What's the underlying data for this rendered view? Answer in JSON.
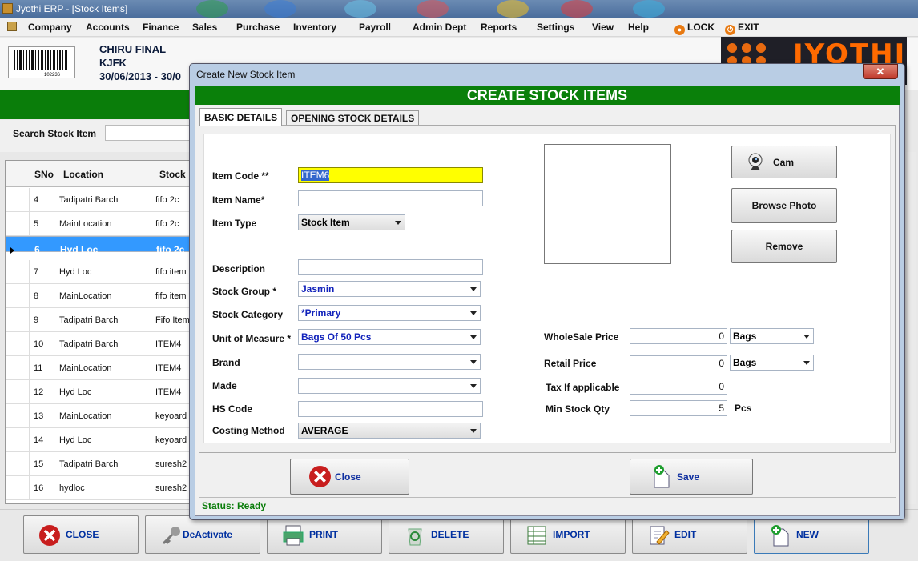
{
  "window": {
    "title": "Jyothi ERP - [Stock Items]"
  },
  "menu": [
    "Company",
    "Accounts",
    "Finance",
    "Sales",
    "Purchase",
    "Inventory",
    "Payroll",
    "Admin Dept",
    "Reports",
    "Settings",
    "View",
    "Help"
  ],
  "lock_label": "LOCK",
  "exit_label": "EXIT",
  "company": {
    "name": "CHIRU FINAL",
    "code": "KJFK",
    "period": "30/06/2013 - 30/0"
  },
  "barcode_text": "102236",
  "brand_logo": "JYOTHI",
  "search": {
    "label": "Search Stock Item",
    "value": ""
  },
  "grid": {
    "columns": [
      "SNo",
      "Location",
      "Stock"
    ],
    "rows": [
      {
        "sno": "4",
        "location": "Tadipatri Barch",
        "stock": "fifo 2c"
      },
      {
        "sno": "5",
        "location": "MainLocation",
        "stock": "fifo 2c"
      },
      {
        "sno": "6",
        "location": "Hyd Loc",
        "stock": "fifo 2c"
      },
      {
        "sno": "7",
        "location": "Hyd Loc",
        "stock": "fifo item"
      },
      {
        "sno": "8",
        "location": "MainLocation",
        "stock": "fifo item"
      },
      {
        "sno": "9",
        "location": "Tadipatri Barch",
        "stock": "Fifo Item"
      },
      {
        "sno": "10",
        "location": "Tadipatri Barch",
        "stock": "ITEM4"
      },
      {
        "sno": "11",
        "location": "MainLocation",
        "stock": "ITEM4"
      },
      {
        "sno": "12",
        "location": "Hyd Loc",
        "stock": "ITEM4"
      },
      {
        "sno": "13",
        "location": "MainLocation",
        "stock": "keyoard"
      },
      {
        "sno": "14",
        "location": "Hyd Loc",
        "stock": "keyoard"
      },
      {
        "sno": "15",
        "location": "Tadipatri Barch",
        "stock": "suresh2"
      },
      {
        "sno": "16",
        "location": "hydloc",
        "stock": "suresh2"
      }
    ],
    "selected_row": 2
  },
  "bottom_buttons": [
    "CLOSE",
    "DeActivate",
    "PRINT",
    "DELETE",
    "IMPORT",
    "EDIT",
    "NEW"
  ],
  "dialog": {
    "title": "Create New Stock Item",
    "close_glyph": "✕",
    "header": "CREATE STOCK ITEMS",
    "tabs": [
      "BASIC DETAILS",
      "OPENING STOCK DETAILS"
    ],
    "fields": {
      "item_code": {
        "label": "Item Code **",
        "value": "ITEM6"
      },
      "item_name": {
        "label": "Item Name*",
        "value": ""
      },
      "item_type": {
        "label": "Item Type",
        "value": "Stock Item"
      },
      "description": {
        "label": "Description",
        "value": ""
      },
      "stock_group": {
        "label": "Stock Group *",
        "value": "Jasmin"
      },
      "stock_category": {
        "label": "Stock Category",
        "value": "*Primary"
      },
      "unit_of_measure": {
        "label": "Unit of Measure *",
        "value": "Bags Of 50 Pcs"
      },
      "brand": {
        "label": "Brand",
        "value": ""
      },
      "made": {
        "label": "Made",
        "value": ""
      },
      "hs_code": {
        "label": "HS Code",
        "value": ""
      },
      "costing_method": {
        "label": "Costing Method",
        "value": "AVERAGE"
      },
      "wholesale_price": {
        "label": "WholeSale Price",
        "value": "0",
        "unit": "Bags"
      },
      "retail_price": {
        "label": "Retail Price",
        "value": "0",
        "unit": "Bags"
      },
      "tax": {
        "label": "Tax If applicable",
        "value": "0"
      },
      "min_stock_qty": {
        "label": "Min Stock Qty",
        "value": "5",
        "unit": "Pcs"
      }
    },
    "buttons": {
      "cam": "Cam",
      "browse": "Browse Photo",
      "remove": "Remove",
      "close": "Close",
      "save": "Save"
    },
    "status": "Status: Ready"
  },
  "colors": {
    "header_green": "#0a800a",
    "selection": "#3399ff",
    "highlight": "#ffff00"
  }
}
